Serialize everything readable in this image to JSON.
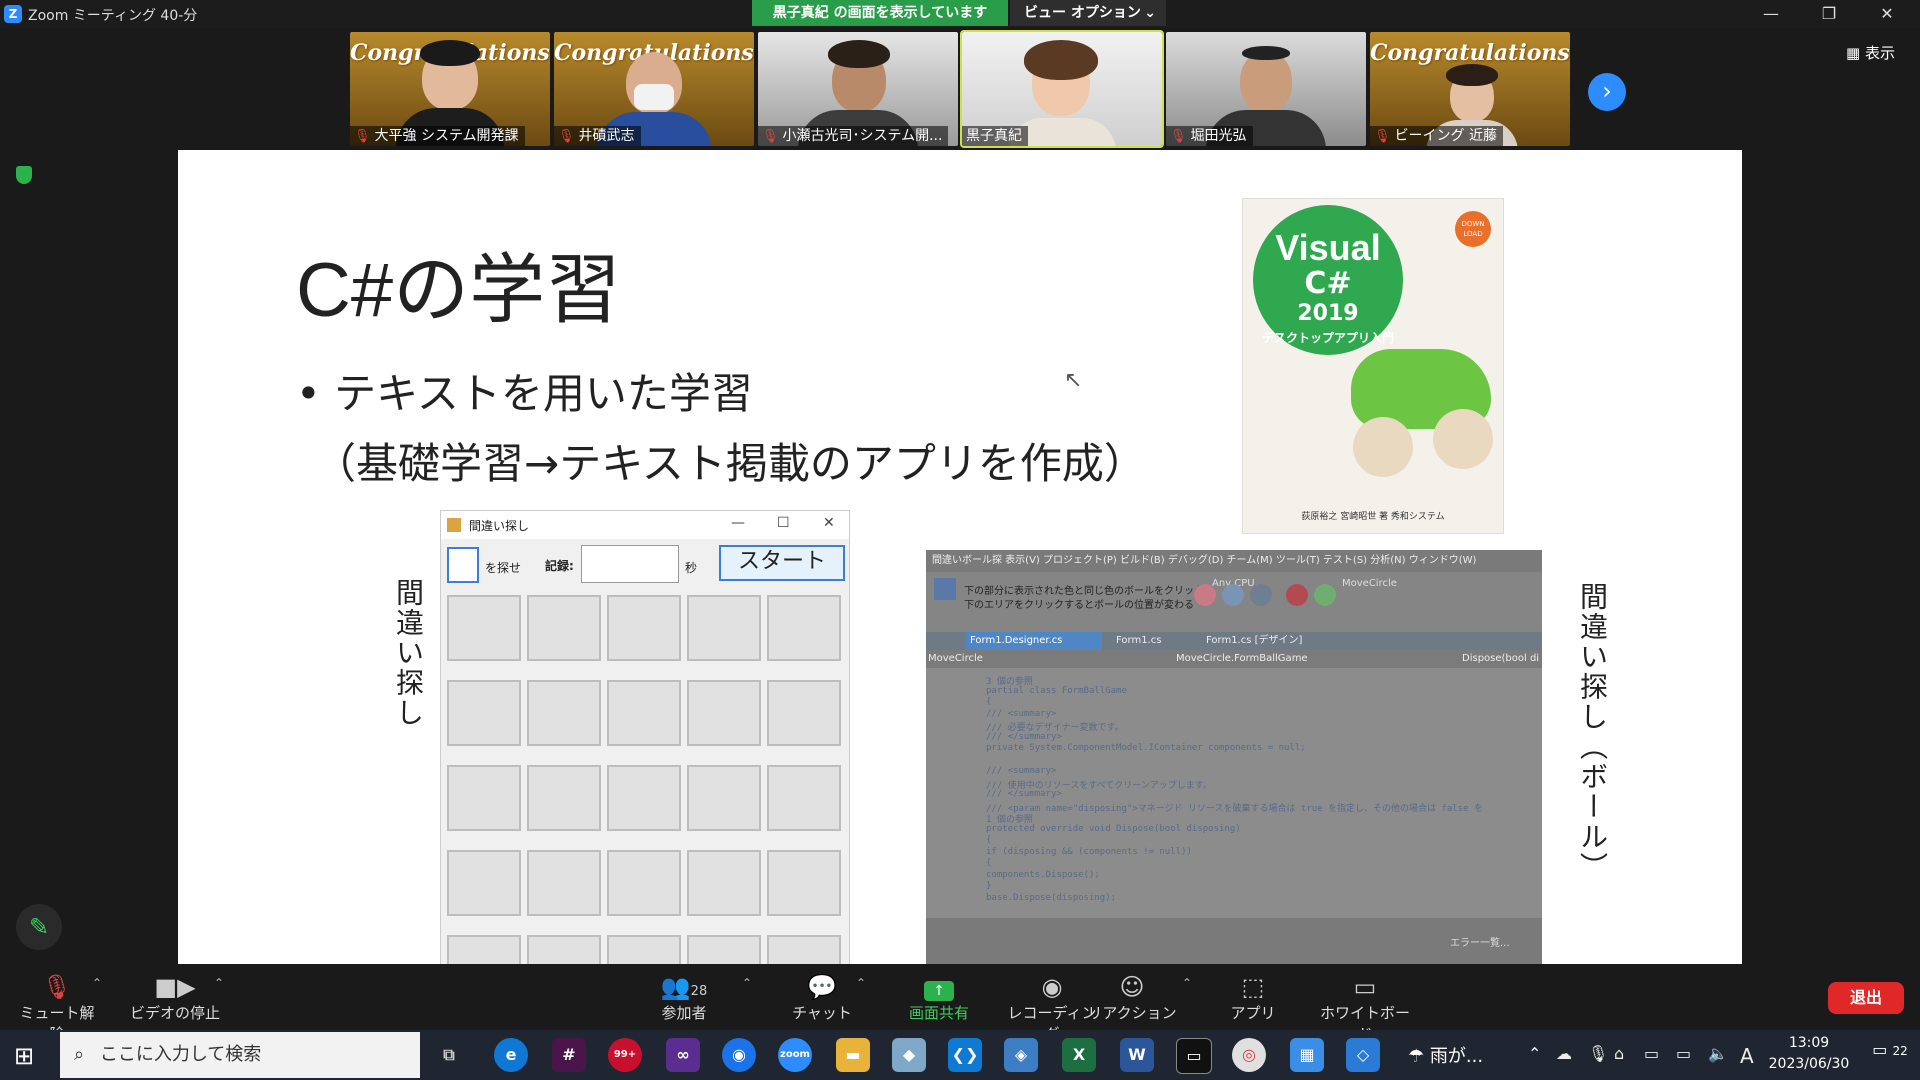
{
  "window": {
    "title": "Zoom ミーティング 40-分",
    "share_banner": "黒子真紀 の画面を表示しています",
    "view_options": "ビュー オプション",
    "logo_letter": "Z",
    "minimize": "—",
    "restore": "❐",
    "close": "✕"
  },
  "participants": [
    {
      "name": "大平強 システム開発課",
      "muted": true,
      "banner": "Congratulations!"
    },
    {
      "name": "井磧武志",
      "muted": true,
      "banner": "Congratulations!"
    },
    {
      "name": "小瀬古光司･システム開...",
      "muted": true,
      "banner": ""
    },
    {
      "name": "黒子真紀",
      "muted": false,
      "banner": ""
    },
    {
      "name": "堀田光弘",
      "muted": true,
      "banner": ""
    },
    {
      "name": "ビーイング 近藤",
      "muted": true,
      "banner": "Congratulations!"
    }
  ],
  "view_button": "表示",
  "next_page_glyph": "›",
  "slide": {
    "title": "C#の学習",
    "bullet": "• テキストを用いた学習",
    "sub": "（基礎学習→テキスト掲載のアプリを作成）",
    "left_vertical": "間違い探し",
    "right_vertical": "間違い探し（ボール）",
    "book": {
      "line1": "Visual",
      "line2": "C#",
      "line3": "2019",
      "line4": "デスクトップアプリ入門",
      "badge": "DOWN LOAD",
      "publisher": "荻原裕之 宮崎昭世 著 秀和システム"
    },
    "game_window": {
      "title": "間違い探し",
      "label_find": "を探せ",
      "label_record": "記録:",
      "label_sec": "秒",
      "start_button": "スタート",
      "rows": 5,
      "cols": 5
    },
    "ide": {
      "menubar": "間違いボール探 表示(V)  プロジェクト(P)  ビルド(B)  デバッグ(D)  チーム(M)  ツール(T)  テスト(S)  分析(N)  ウィンドウ(W)",
      "msg1": "下の部分に表示された色と同じ色のボールをクリック",
      "msg2": "下のエリアをクリックするとボールの位置が変わる",
      "tab1": "Form1.Designer.cs",
      "tab2": "Form1.cs",
      "tab3": "Form1.cs [デザイン]",
      "nav_left": "MoveCircle",
      "nav_mid": "MoveCircle.FormBallGame",
      "nav_right": "Dispose(bool di",
      "any_cpu": "Any CPU",
      "project": "MoveCircle",
      "code": [
        "3 個の参照",
        "partial class FormBallGame",
        "{",
        "/// <summary>",
        "/// 必要なデザイナー変数です。",
        "/// </summary>",
        "private System.ComponentModel.IContainer components = null;",
        "",
        "/// <summary>",
        "/// 使用中のリソースをすべてクリーンアップします。",
        "/// </summary>",
        "/// <param name=\"disposing\">マネージド リソースを破棄する場合は true を指定し、その他の場合は false を",
        "1 個の参照",
        "protected override void Dispose(bool disposing)",
        "{",
        "if (disposing && (components != null))",
        "{",
        "components.Dispose();",
        "}",
        "base.Dispose(disposing);"
      ],
      "error_panel": "エラー一覧..."
    }
  },
  "toolbar": {
    "mute": "ミュート解除",
    "video": "ビデオの停止",
    "participants": "参加者",
    "participants_count": "28",
    "chat": "チャット",
    "share": "画面共有",
    "record": "レコーディング",
    "reactions": "リアクション",
    "apps": "アプリ",
    "whiteboard": "ホワイトボード",
    "leave": "退出"
  },
  "taskbar": {
    "search_placeholder": "ここに入力して検索",
    "weather": "雨が...",
    "time": "13:09",
    "date": "2023/06/30",
    "ime": "A",
    "notifications": "22",
    "mail_badge": "99+"
  },
  "colors": {
    "share_green": "#2a9d4a",
    "zoom_blue": "#2d8cff",
    "leave_red": "#e02828"
  }
}
